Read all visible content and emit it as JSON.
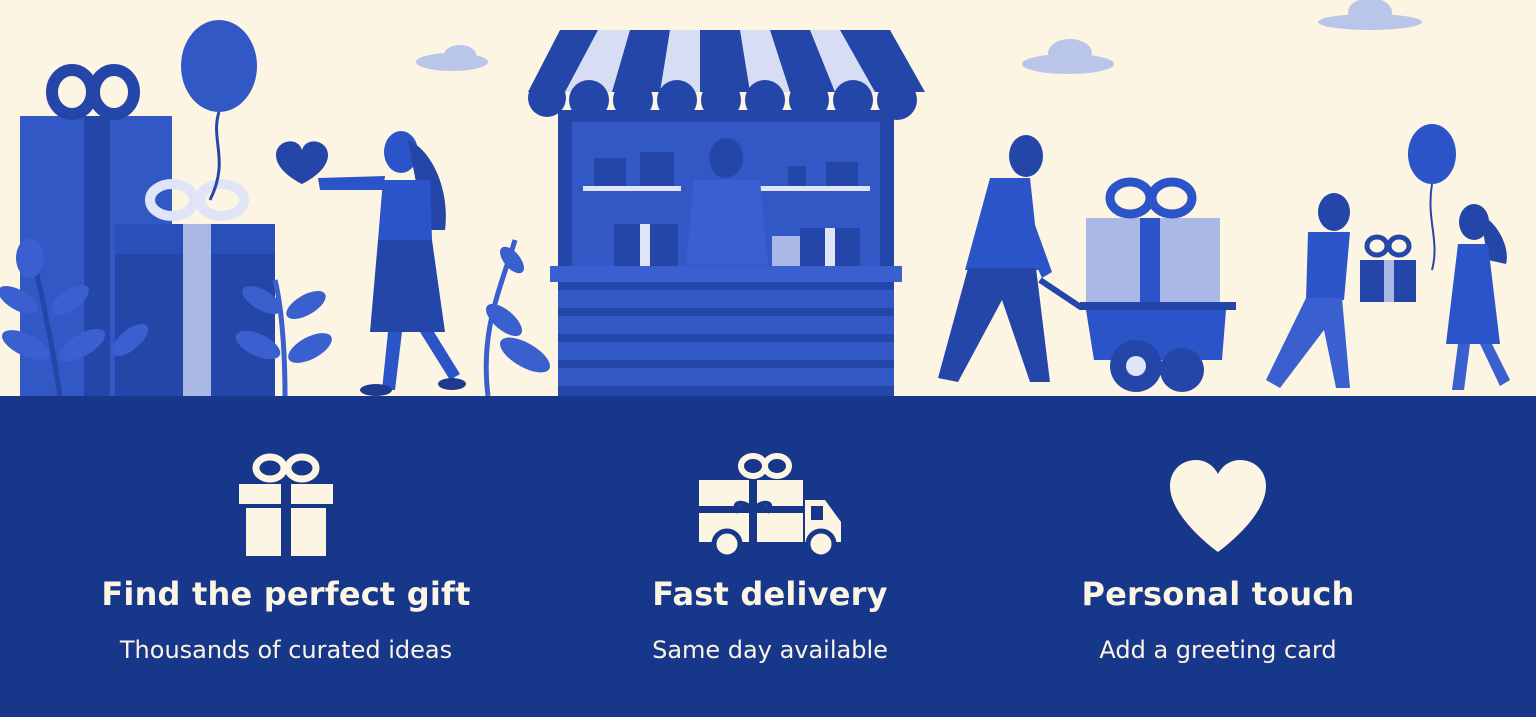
{
  "colors": {
    "background_cream": "#fdf5e4",
    "band_navy": "#17388a",
    "primary_blue": "#2c54c9",
    "light_blue": "#aab8e6",
    "text_light": "#fdf5e4"
  },
  "hero": {
    "illustration": "gift-market-scene"
  },
  "features": [
    {
      "icon": "gift-box-icon",
      "title": "Find the perfect gift",
      "subtitle": "Thousands of curated ideas"
    },
    {
      "icon": "delivery-truck-icon",
      "title": "Fast delivery",
      "subtitle": "Same day available"
    },
    {
      "icon": "heart-icon",
      "title": "Personal touch",
      "subtitle": "Add a greeting card"
    }
  ]
}
